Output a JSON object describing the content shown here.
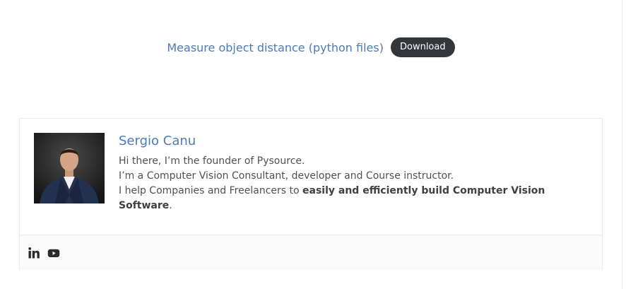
{
  "download": {
    "link_text": "Measure object distance (python files)",
    "button_label": "Download"
  },
  "author": {
    "name": "Sergio Canu",
    "bio_line1": "Hi there, I’m the founder of Pysource.",
    "bio_line2": "I’m a Computer Vision Consultant, developer and Course instructor.",
    "bio_line3_prefix": "I help Companies and Freelancers to ",
    "bio_line3_bold": "easily and efficiently build Computer Vision Software",
    "bio_line3_suffix": ".",
    "avatar_icon": "person-photo"
  },
  "social": {
    "icons": [
      "linkedin-icon",
      "youtube-icon"
    ]
  },
  "colors": {
    "link": "#4a7bb7",
    "button_bg": "#33363a",
    "button_text": "#ffffff",
    "text": "#505050",
    "border": "#ececec"
  }
}
